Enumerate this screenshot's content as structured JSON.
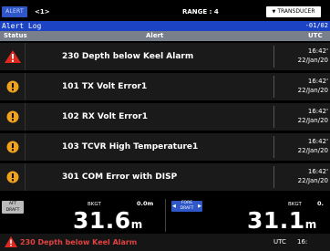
{
  "topbar": {
    "alert_button": "ALERT",
    "alert_count": "<1>",
    "range": "RANGE : 4",
    "transducer_button": "TRANSDUCER"
  },
  "alert_log": {
    "title": "Alert Log",
    "date_partial": "-01/02",
    "columns": {
      "status": "Status",
      "alert": "Alert",
      "utc": "UTC"
    }
  },
  "alerts": [
    {
      "icon": "alarm-triangle-icon",
      "text": "230 Depth below Keel Alarm",
      "time": "16:42'",
      "date": "22/Jan/20"
    },
    {
      "icon": "warning-circle-icon",
      "text": "101 TX Volt Error1",
      "time": "16:42'",
      "date": "22/Jan/20"
    },
    {
      "icon": "warning-circle-icon",
      "text": "102 RX Volt Error1",
      "time": "16:42'",
      "date": "22/Jan/20"
    },
    {
      "icon": "warning-circle-icon",
      "text": "103 TCVR High Temperature1",
      "time": "16:42'",
      "date": "22/Jan/20"
    },
    {
      "icon": "warning-circle-icon",
      "text": "301 COM Error with DISP",
      "time": "16:42'",
      "date": "22/Jan/20"
    }
  ],
  "panels": {
    "left": {
      "badge": "AFT\nDRAFT",
      "label": "BKGT",
      "offset": "0.0m",
      "value": "31.6",
      "unit": "m"
    },
    "right": {
      "badge": "FORE\nDRAFT",
      "label": "BKGT",
      "offset": "0.",
      "value": "31.1",
      "unit": "m"
    }
  },
  "bottom_bar": {
    "text": "230 Depth below Keel Alarm",
    "utc_label": "UTC",
    "time": "16:"
  },
  "colors": {
    "alarm_red": "#e0281e",
    "warning_orange": "#f0a21a",
    "accent_blue": "#1b43c4"
  }
}
